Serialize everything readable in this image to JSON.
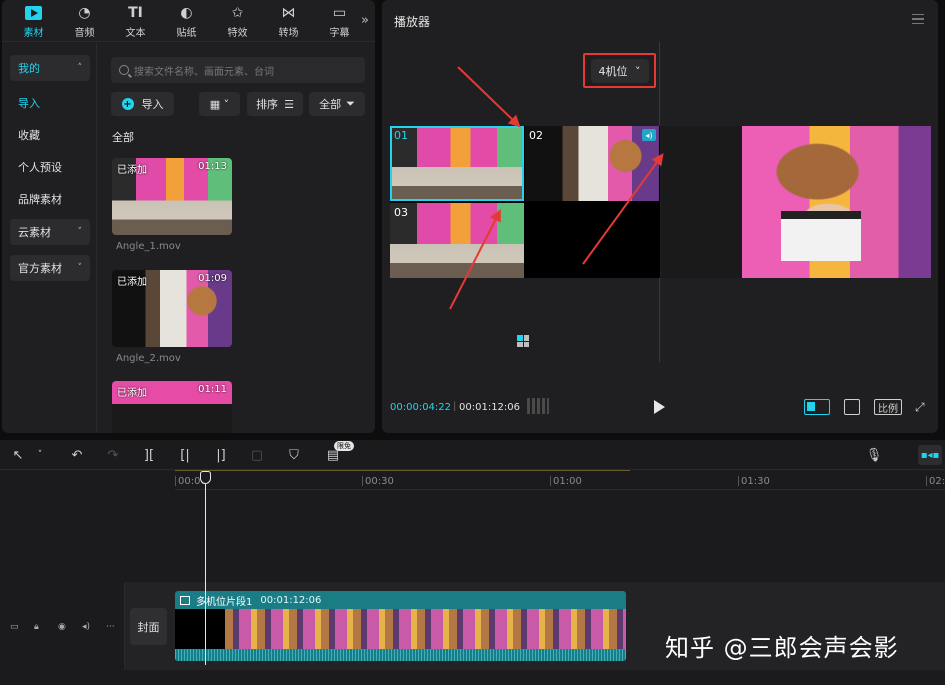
{
  "tabs": [
    {
      "label": "素材",
      "icon": "media-icon"
    },
    {
      "label": "音频",
      "icon": "audio-icon"
    },
    {
      "label": "文本",
      "icon": "text-icon"
    },
    {
      "label": "贴纸",
      "icon": "sticker-icon"
    },
    {
      "label": "特效",
      "icon": "effects-icon"
    },
    {
      "label": "转场",
      "icon": "transition-icon"
    },
    {
      "label": "字幕",
      "icon": "caption-icon"
    }
  ],
  "sidebar": {
    "mine": "我的",
    "import": "导入",
    "favorites": "收藏",
    "presets": "个人预设",
    "brand": "品牌素材",
    "cloud": "云素材",
    "official": "官方素材"
  },
  "media": {
    "search_placeholder": "搜索文件名称、画面元素、台词",
    "import_label": "导入",
    "sort_label": "排序",
    "filter_label": "全部",
    "all_heading": "全部",
    "added_label": "已添加",
    "items": [
      {
        "name": "Angle_1.mov",
        "duration": "01:13"
      },
      {
        "name": "Angle_2.mov",
        "duration": "01:09"
      },
      {
        "name": "",
        "duration": "01:11"
      }
    ]
  },
  "player": {
    "title": "播放器",
    "camera_select": "4机位",
    "cells": [
      "01",
      "02",
      "03"
    ],
    "time_current": "00:00:04:22",
    "time_total": "00:01:12:06",
    "ratio_label": "比例"
  },
  "timeline": {
    "limit_badge": "限免",
    "ruler": [
      "00:00",
      "00:30",
      "01:00",
      "01:30",
      "02:0"
    ],
    "cover_label": "封面",
    "clip_name": "多机位片段1",
    "clip_duration": "00:01:12:06"
  },
  "watermark": "知乎 @三郎会声会影",
  "colors": {
    "accent": "#22d3ee",
    "highlight": "#e53935",
    "clip": "#1a7d86"
  }
}
